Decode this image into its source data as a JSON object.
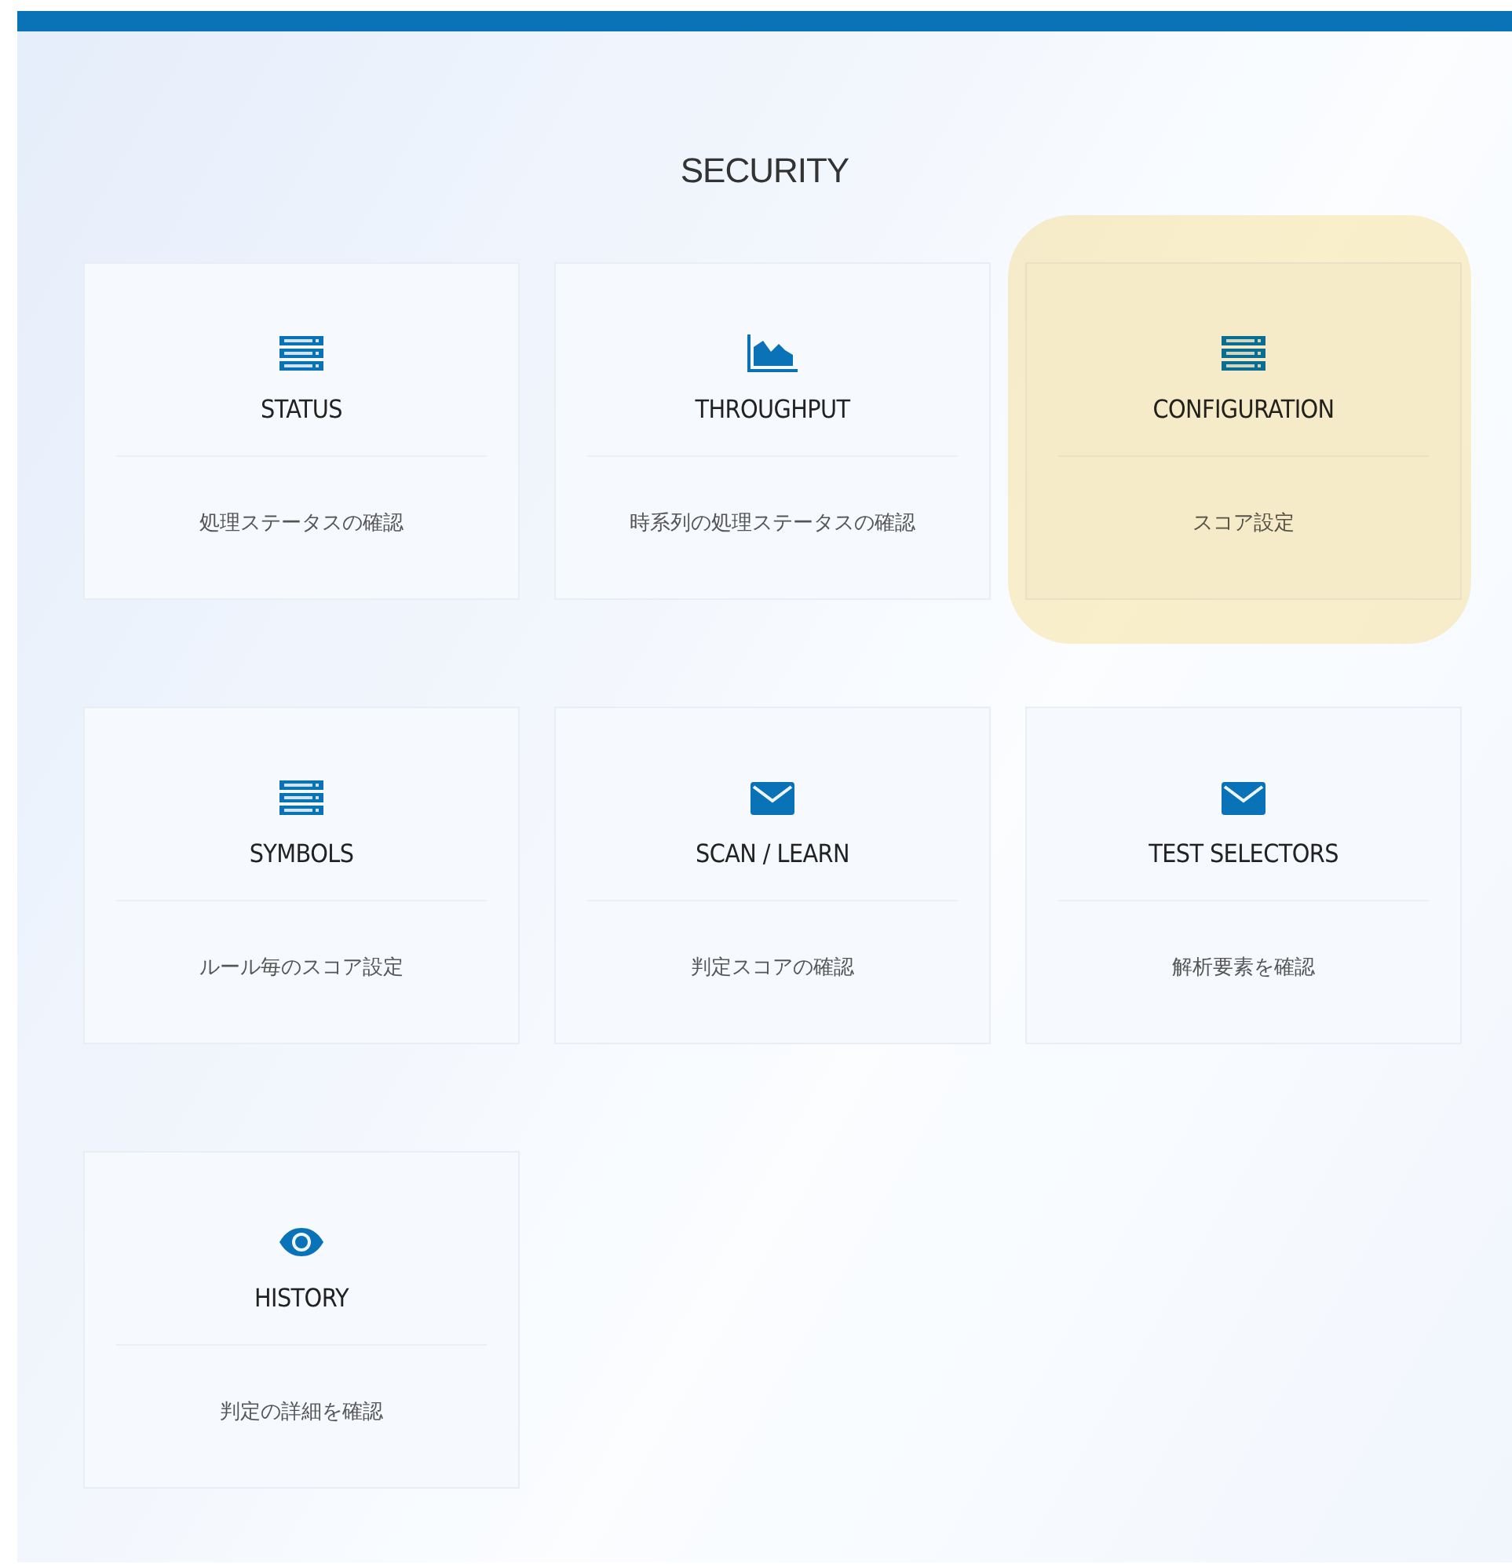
{
  "section_title": "SECURITY",
  "cards": [
    {
      "kind": "server",
      "title": "STATUS",
      "description": "処理ステータスの確認",
      "highlighted": false
    },
    {
      "kind": "chart",
      "title": "THROUGHPUT",
      "description": "時系列の処理ステータスの確認",
      "highlighted": false
    },
    {
      "kind": "server",
      "title": "CONFIGURATION",
      "description": "スコア設定",
      "highlighted": true
    },
    {
      "kind": "server",
      "title": "SYMBOLS",
      "description": "ルール毎のスコア設定",
      "highlighted": false
    },
    {
      "kind": "envelope",
      "title": "SCAN / LEARN",
      "description": "判定スコアの確認",
      "highlighted": false
    },
    {
      "kind": "envelope",
      "title": "TEST SELECTORS",
      "description": "解析要素を確認",
      "highlighted": false
    },
    {
      "kind": "eye",
      "title": "HISTORY",
      "description": "判定の詳細を確認",
      "highlighted": false
    }
  ]
}
